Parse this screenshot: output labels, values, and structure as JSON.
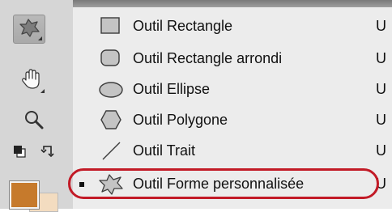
{
  "colors": {
    "foreground_swatch": "#c67a2c",
    "background_swatch": "#f3dcc0",
    "highlight_ring": "#c21a26"
  },
  "toolbar": {
    "tools": [
      {
        "name": "custom-shape-tool",
        "icon": "custom-shape-icon",
        "active": true
      },
      {
        "name": "hand-tool",
        "icon": "hand-icon",
        "active": false
      },
      {
        "name": "zoom-tool",
        "icon": "magnifier-icon",
        "active": false
      },
      {
        "name": "default-colors",
        "icon": "default-colors-icon",
        "active": false
      },
      {
        "name": "swap-colors",
        "icon": "swap-colors-icon",
        "active": false
      }
    ]
  },
  "menu": {
    "items": [
      {
        "label": "Outil Rectangle",
        "shortcut": "U",
        "icon": "rectangle-icon",
        "selected": false
      },
      {
        "label": "Outil Rectangle arrondi",
        "shortcut": "U",
        "icon": "rounded-rectangle-icon",
        "selected": false
      },
      {
        "label": "Outil Ellipse",
        "shortcut": "U",
        "icon": "ellipse-icon",
        "selected": false
      },
      {
        "label": "Outil Polygone",
        "shortcut": "U",
        "icon": "polygon-icon",
        "selected": false
      },
      {
        "label": "Outil Trait",
        "shortcut": "U",
        "icon": "line-icon",
        "selected": false
      },
      {
        "label": "Outil Forme personnalisée",
        "shortcut": "U",
        "icon": "custom-shape-icon",
        "selected": true
      }
    ]
  }
}
